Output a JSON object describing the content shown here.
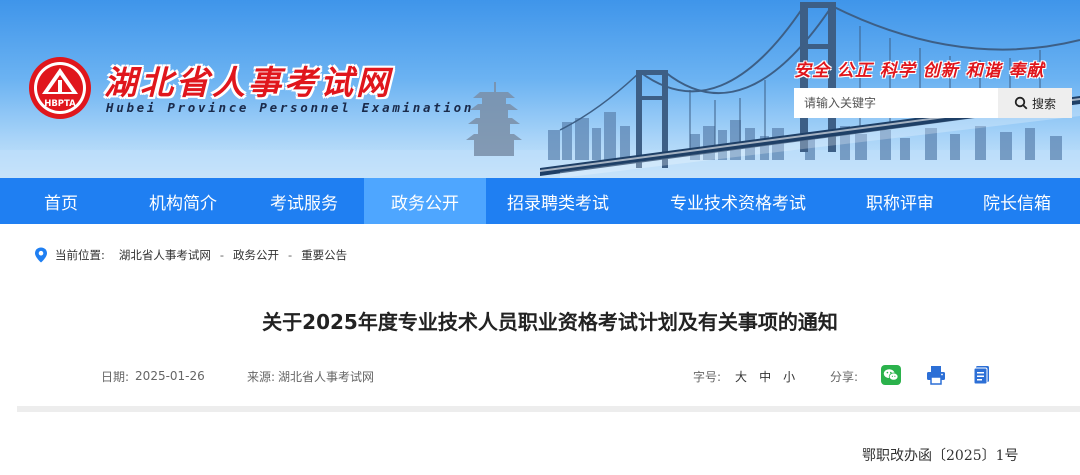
{
  "header": {
    "site_name_cn": "湖北省人事考试网",
    "site_name_en": "Hubei Province Personnel Examination",
    "logo_text": "HBPTA",
    "slogan": "安全 公正 科学 创新 和谐 奉献",
    "search": {
      "placeholder": "请输入关键字",
      "button_label": "搜索"
    }
  },
  "nav": {
    "items": [
      {
        "label": "首页"
      },
      {
        "label": "机构简介"
      },
      {
        "label": "考试服务"
      },
      {
        "label": "政务公开",
        "active": true
      },
      {
        "label": "招录聘类考试"
      },
      {
        "label": "专业技术资格考试"
      },
      {
        "label": "职称评审"
      },
      {
        "label": "院长信箱"
      }
    ]
  },
  "breadcrumb": {
    "prefix": "当前位置:",
    "items": [
      "湖北省人事考试网",
      "政务公开",
      "重要公告"
    ],
    "separator": "-"
  },
  "article": {
    "title": "关于2025年度专业技术人员职业资格考试计划及有关事项的通知",
    "date_label": "日期:",
    "date": "2025-01-26",
    "source_label": "来源:",
    "source": "湖北省人事考试网",
    "font_size_label": "字号:",
    "font_sizes": [
      "大",
      "中",
      "小"
    ],
    "share_label": "分享:",
    "share_icons": [
      "wechat-icon",
      "print-icon",
      "document-icon"
    ],
    "doc_number": "鄂职改办函〔2025〕1号"
  },
  "colors": {
    "nav_bg": "#1f7ff2",
    "nav_active": "#4ea6ff",
    "brand_red": "#e0161c",
    "wechat_green": "#2bb24c",
    "icon_blue": "#2c6fd6"
  }
}
